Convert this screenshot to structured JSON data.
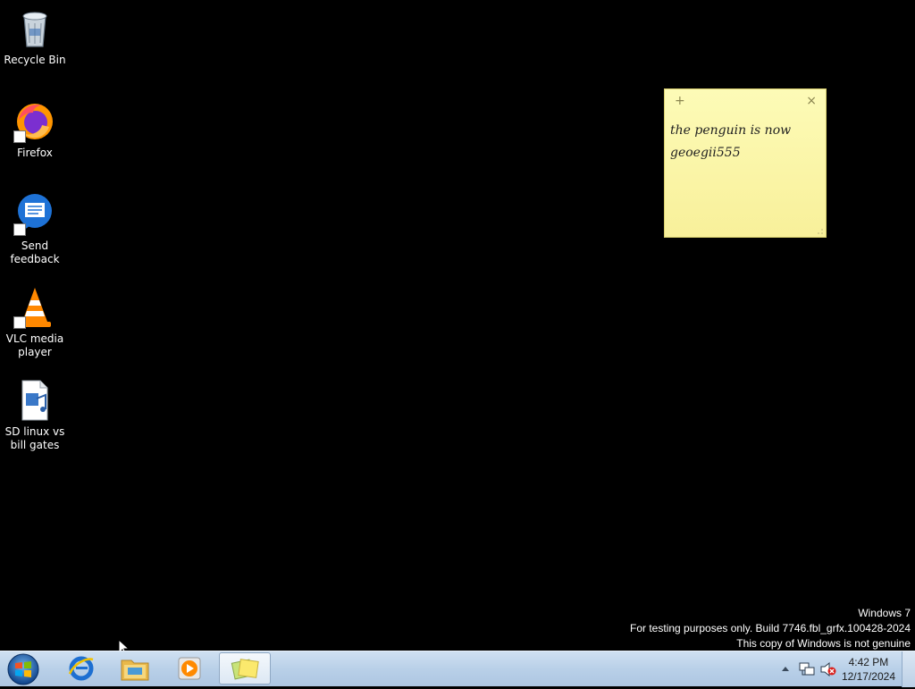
{
  "desktop": {
    "icons": [
      {
        "label": "Recycle Bin",
        "icon": "recycle-bin-icon"
      },
      {
        "label": "Firefox",
        "icon": "firefox-icon"
      },
      {
        "label": "Send feedback",
        "icon": "send-feedback-icon"
      },
      {
        "label": "VLC media player",
        "icon": "vlc-icon"
      },
      {
        "label": "SD linux vs bill gates",
        "icon": "media-file-icon"
      }
    ]
  },
  "sticky_note": {
    "add_glyph": "+",
    "close_glyph": "×",
    "text": "the penguin is now geoegii555"
  },
  "watermark": {
    "line1": "Windows 7",
    "line2": "For testing purposes only. Build 7746.fbl_grfx.100428-2024",
    "line3": "This copy of Windows is not genuine"
  },
  "taskbar": {
    "pinned": [
      {
        "name": "internet-explorer",
        "icon": "ie-icon"
      },
      {
        "name": "windows-explorer",
        "icon": "folder-icon"
      },
      {
        "name": "media-player",
        "icon": "media-player-icon"
      },
      {
        "name": "sticky-notes",
        "icon": "sticky-notes-icon",
        "active": true
      }
    ],
    "clock": {
      "time": "4:42 PM",
      "date": "12/17/2024"
    }
  },
  "colors": {
    "desktop_bg": "#000000",
    "sticky_bg": "#fdfbb7",
    "taskbar_bg": "#b9d0e8"
  }
}
